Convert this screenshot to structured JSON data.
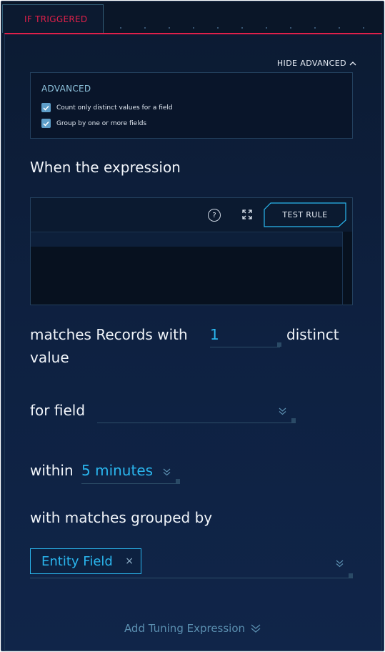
{
  "tab": {
    "label": "IF TRIGGERED"
  },
  "toggle": {
    "label": "HIDE ADVANCED",
    "icon": "chevron-up-icon"
  },
  "advanced": {
    "title": "ADVANCED",
    "options": [
      {
        "label": "Count only distinct values for a field",
        "checked": true
      },
      {
        "label": "Group by one or more fields",
        "checked": true
      }
    ]
  },
  "expression": {
    "heading": "When the expression",
    "help_icon": "help-circle-icon",
    "expand_icon": "expand-icon",
    "test_button": "TEST RULE"
  },
  "matches": {
    "prefix": "matches Records with",
    "count": "1",
    "suffix_1": "distinct",
    "suffix_2": "value"
  },
  "field": {
    "label": "for field",
    "value": ""
  },
  "within": {
    "label": "within",
    "value": "5 minutes"
  },
  "grouped": {
    "heading": "with matches grouped by",
    "chips": [
      "Entity Field"
    ]
  },
  "footer": {
    "add_tuning": "Add Tuning Expression"
  },
  "colors": {
    "accent": "#2ab6ee",
    "tab_active": "#e0204a",
    "background": "#0d1f3c"
  }
}
